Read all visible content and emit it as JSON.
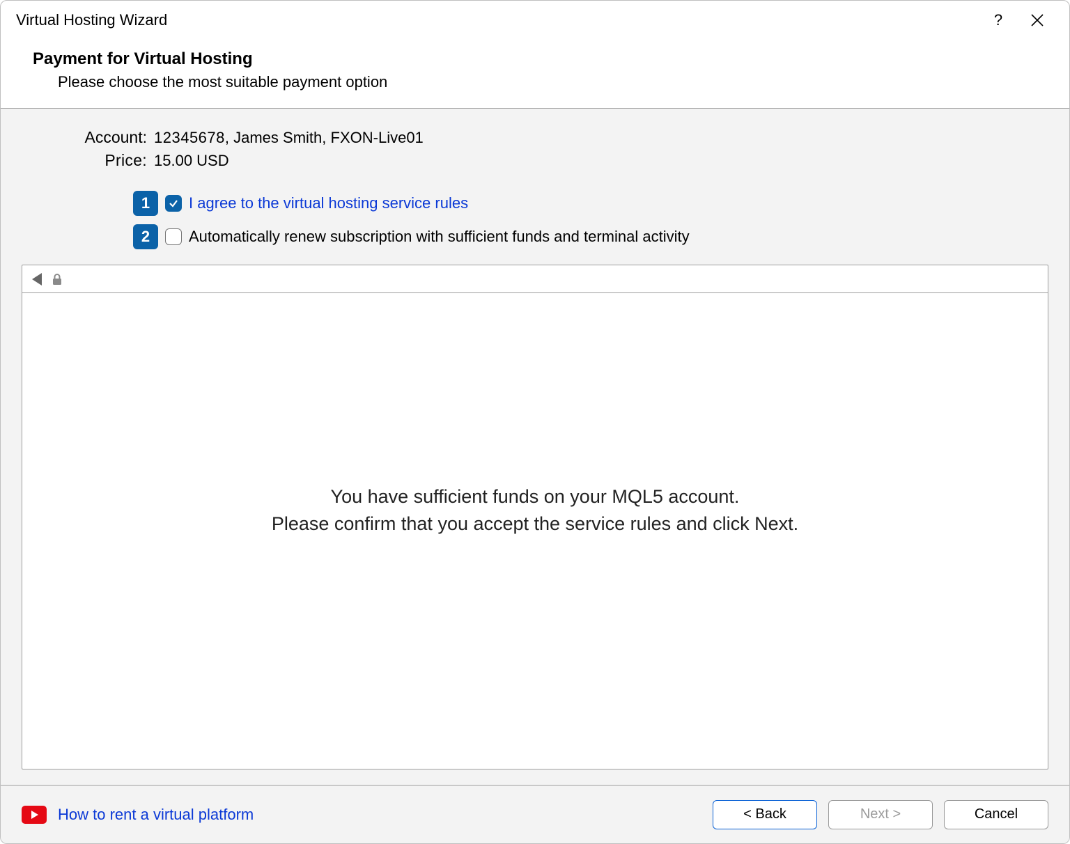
{
  "window": {
    "title": "Virtual Hosting Wizard"
  },
  "header": {
    "title": "Payment for Virtual Hosting",
    "subtitle": "Please choose the most suitable payment option"
  },
  "account": {
    "label": "Account:",
    "number": "12345678",
    "name": "James Smith",
    "server": "FXON-Live01"
  },
  "price": {
    "label": "Price:",
    "value": "15.00 USD"
  },
  "badges": {
    "one": "1",
    "two": "2"
  },
  "checks": {
    "agree": {
      "checked": true,
      "label": "I agree to the virtual hosting service rules"
    },
    "renew": {
      "checked": false,
      "label": "Automatically renew subscription with sufficient funds and terminal activity"
    }
  },
  "frame": {
    "line1": "You have sufficient funds on your MQL5 account.",
    "line2": "Please confirm that you accept the service rules and click Next."
  },
  "footer": {
    "help_link": "How to rent a virtual platform",
    "back": "< Back",
    "next": "Next >",
    "cancel": "Cancel"
  }
}
